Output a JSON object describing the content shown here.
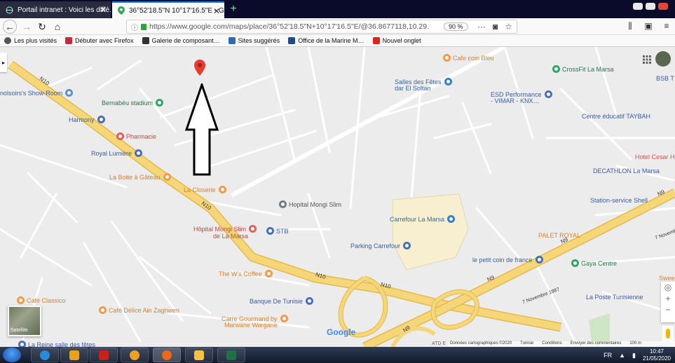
{
  "tabs": [
    {
      "label": "Portail intranet : Voici les diffé…",
      "icon": "globe-icon",
      "active": false
    },
    {
      "label": "36°52'18.5\"N 10°17'16.5\"E - Go…",
      "icon": "google-maps-icon",
      "active": true
    }
  ],
  "nav": {
    "url": "https://www.google.com/maps/place/36°52'18.5\"N+10°17'16.5\"E/@36.8677118,10.29…",
    "zoom": "90 %"
  },
  "bookmarks": [
    {
      "label": "Les plus visités",
      "icon": "gear-icon"
    },
    {
      "label": "Débuter avec Firefox",
      "icon": "firefox-icon"
    },
    {
      "label": "Galerie de composant…",
      "icon": "gallery-icon"
    },
    {
      "label": "Sites suggérés",
      "icon": "bing-icon"
    },
    {
      "label": "Office de la Marine M…",
      "icon": "flag-icon"
    },
    {
      "label": "Nouvel onglet",
      "icon": "youtube-icon"
    }
  ],
  "map": {
    "pois": [
      {
        "label": "Cafe coin Bleu",
        "color": "#f29a4a"
      },
      {
        "label": "CrossFit La Marsa",
        "color": "#2ea56a"
      },
      {
        "label": "BSB T",
        "color": "#4a6fb5"
      },
      {
        "label": "nolsoirs's Show-Room",
        "color": "#5b8fd1"
      },
      {
        "label": "Salles des Fêtes",
        "color": "#3a7dc9"
      },
      {
        "label": "dar El Soltan",
        "color": "#3a7dc9"
      },
      {
        "label": "ESD Performance",
        "color": "#4a6fb5"
      },
      {
        "label": "- VIMAR - KNX…",
        "color": "#4a6fb5"
      },
      {
        "label": "Bernabéu stadium",
        "color": "#2ea56a"
      },
      {
        "label": "Harmony",
        "color": "#4a6fb5"
      },
      {
        "label": "Centre éducatif TAYBAH",
        "color": "#4a6fb5"
      },
      {
        "label": "Pharmacie",
        "color": "#e0605a"
      },
      {
        "label": "Royal Lumière",
        "color": "#4a6fb5"
      },
      {
        "label": "Hotel Cesar H",
        "color": "#e0605a"
      },
      {
        "label": "La Boite à Gâteau",
        "color": "#f29a4a"
      },
      {
        "label": "DECATHLON La Marsa",
        "color": "#4a6fb5"
      },
      {
        "label": "La Closerie",
        "color": "#f29a4a"
      },
      {
        "label": "Hopital Mongi Slim",
        "color": "#6f7d86"
      },
      {
        "label": "Station-service Shell",
        "color": "#4a6fb5"
      },
      {
        "label": "Carrefour La Marsa",
        "color": "#3a7dc9"
      },
      {
        "label": "Hôpital Mongi Slim",
        "color": "#e0605a"
      },
      {
        "label": "de La Marsa",
        "color": "#e0605a"
      },
      {
        "label": "STB",
        "color": "#4a6fb5"
      },
      {
        "label": "PALET ROYAL",
        "color": "#f29a4a"
      },
      {
        "label": "Parking Carrefour",
        "color": "#4a6fb5"
      },
      {
        "label": "le petit coin de france",
        "color": "#4a6fb5"
      },
      {
        "label": "Gaya Centre",
        "color": "#2ea56a"
      },
      {
        "label": "The W's Coffee",
        "color": "#f29a4a"
      },
      {
        "label": "Swee",
        "color": "#f29a4a"
      },
      {
        "label": "Banque De Tunisie",
        "color": "#4a6fb5"
      },
      {
        "label": "La Poste Tunisienne",
        "color": "#4a6fb5"
      },
      {
        "label": "Café Classico",
        "color": "#f29a4a"
      },
      {
        "label": "Café Délice Ain Zaghwen",
        "color": "#f29a4a"
      },
      {
        "label": "Carre Gourmand by",
        "color": "#f29a4a"
      },
      {
        "label": "Marwane Wargane",
        "color": "#f29a4a"
      },
      {
        "label": "La Reine salle des fêtes",
        "color": "#4a6fb5"
      }
    ],
    "roads": [
      "N10",
      "N10",
      "N10",
      "N9",
      "N9",
      "N9",
      "N10",
      "N9",
      "7 Novembre 1987",
      "7 Novembr"
    ],
    "satellite_label": "Satellite",
    "google_logo": "Google",
    "footer": [
      "Données cartographiques ©2020",
      "Tunisie",
      "Conditions",
      "Envoyer des commentaires",
      "100 m"
    ],
    "atde": "ATD E"
  },
  "taskbar": {
    "language": "FR",
    "time": "10:47",
    "date": "21/05/2020"
  },
  "colors": {
    "highway": "#f5d77a",
    "highway_edge": "#e4b94a",
    "pin": "#e53b30",
    "land": "#ececec"
  }
}
